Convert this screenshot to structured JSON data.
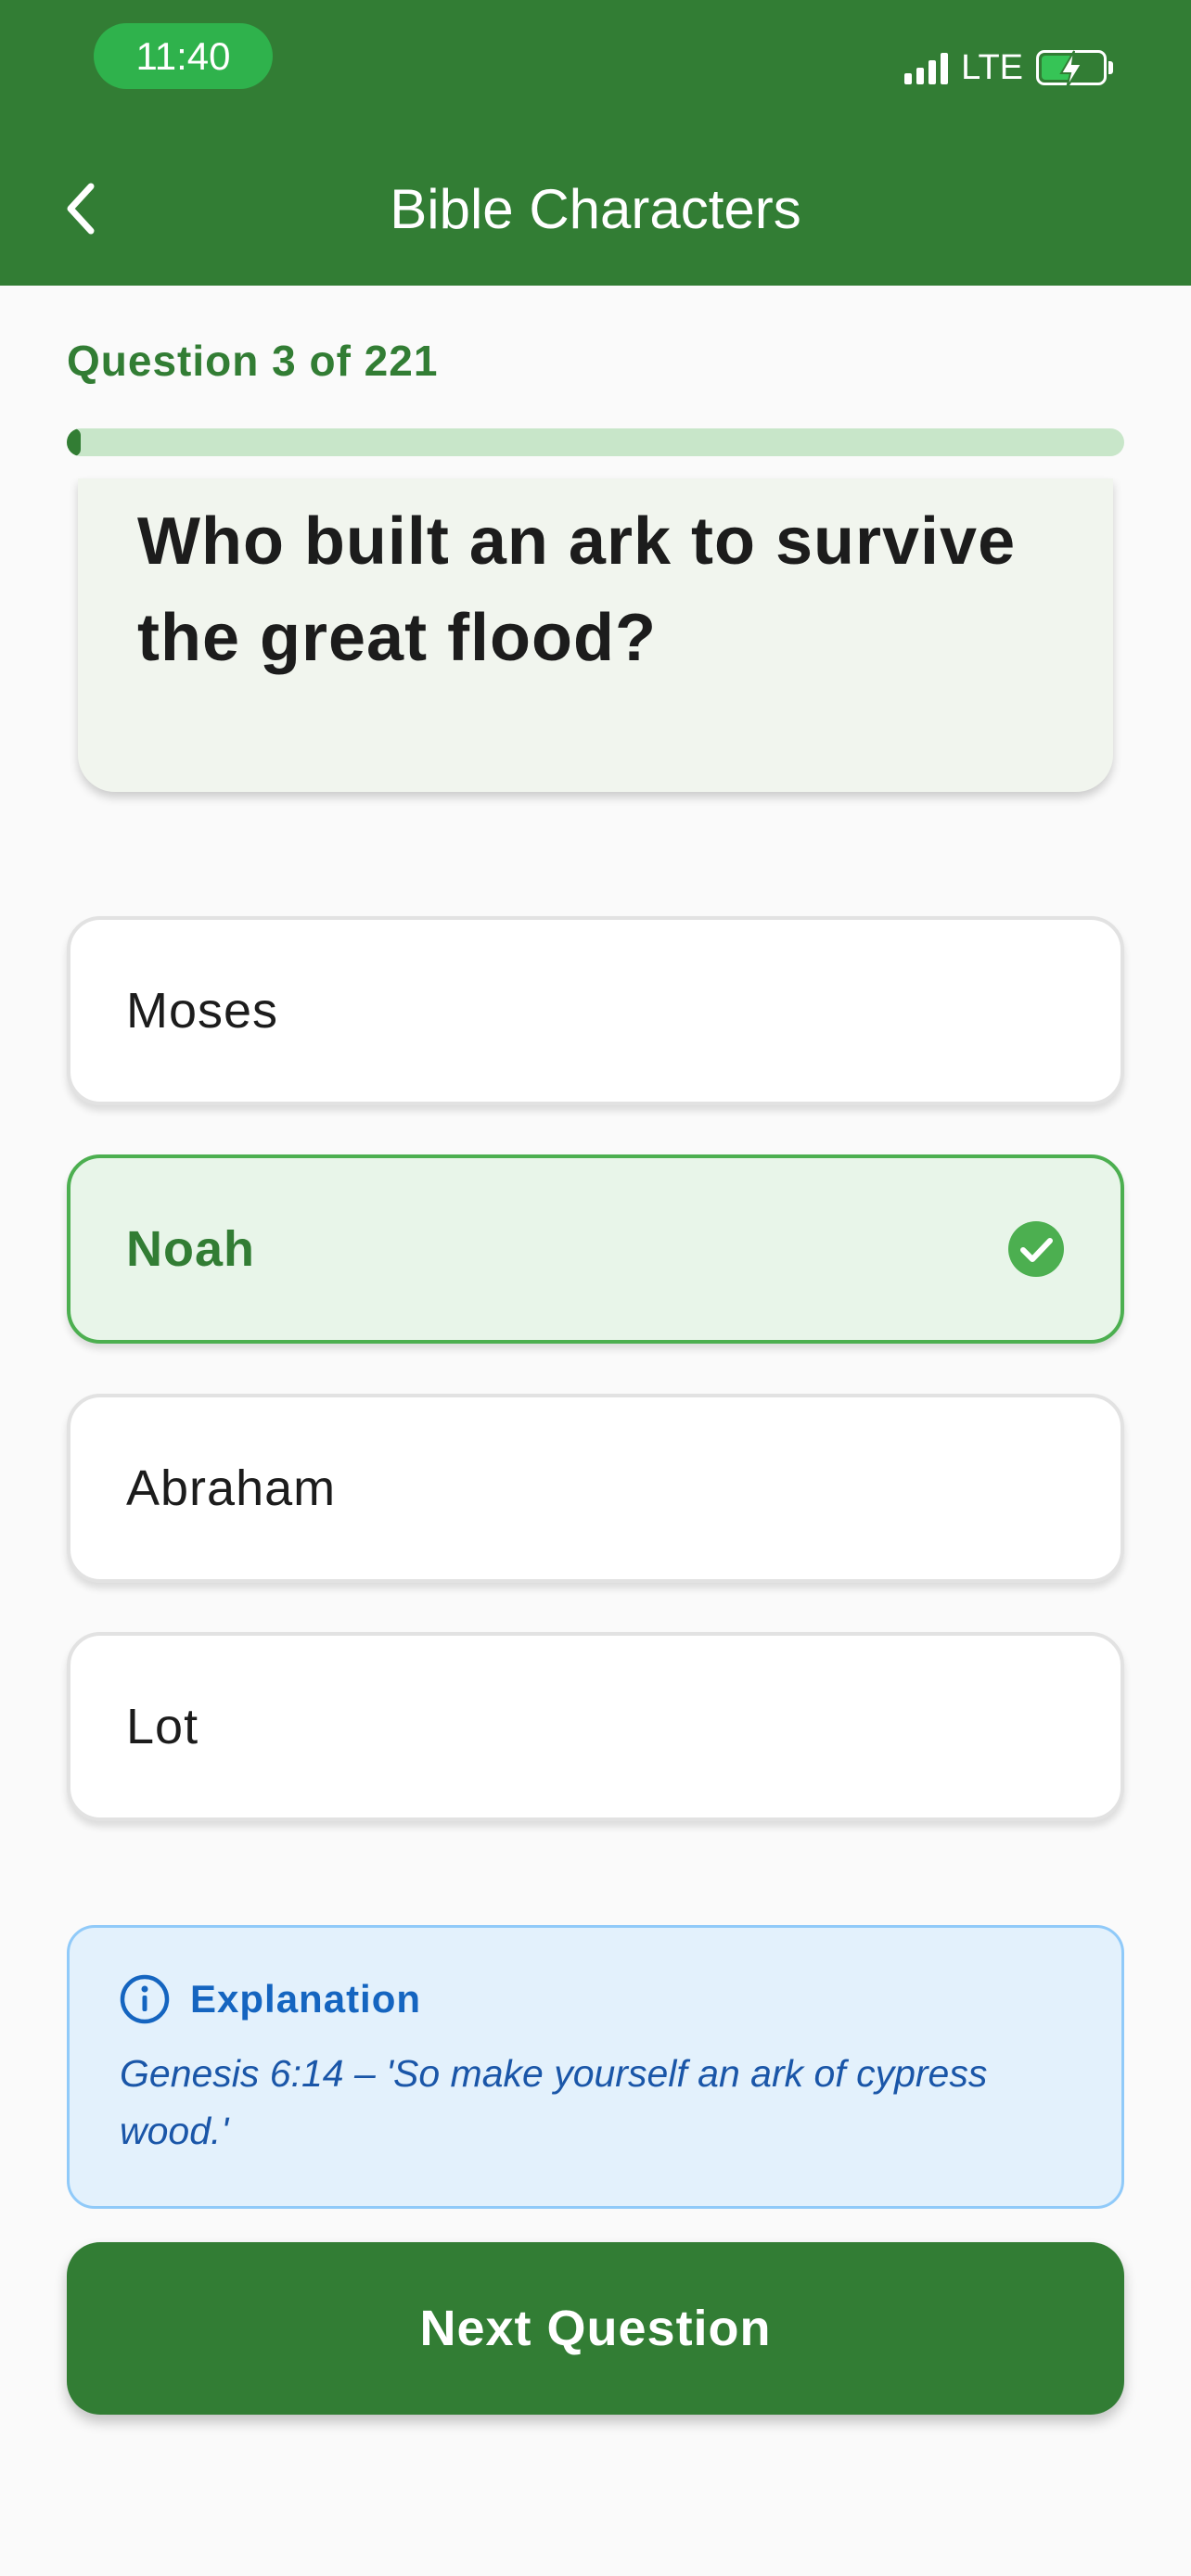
{
  "status_bar": {
    "time": "11:40",
    "network": "LTE"
  },
  "header": {
    "title": "Bible Characters"
  },
  "progress": {
    "label": "Question 3 of 221",
    "current": 3,
    "total": 221
  },
  "question": {
    "text": "Who built an ark to survive the great flood?"
  },
  "options": [
    {
      "label": "Moses",
      "state": "default"
    },
    {
      "label": "Noah",
      "state": "correct"
    },
    {
      "label": "Abraham",
      "state": "default"
    },
    {
      "label": "Lot",
      "state": "default"
    }
  ],
  "explanation": {
    "title": "Explanation",
    "text": "Genesis 6:14 – 'So make yourself an ark of cypress wood.'"
  },
  "next_button": {
    "label": "Next Question"
  },
  "colors": {
    "primary": "#327d34",
    "correct_border": "#4caf50",
    "correct_bg": "#e8f5e9",
    "info_bg": "#e3f1fc",
    "info_text": "#1565c0"
  },
  "icons": {
    "back": "chevron-left-icon",
    "correct": "check-circle-icon",
    "info": "info-icon"
  }
}
